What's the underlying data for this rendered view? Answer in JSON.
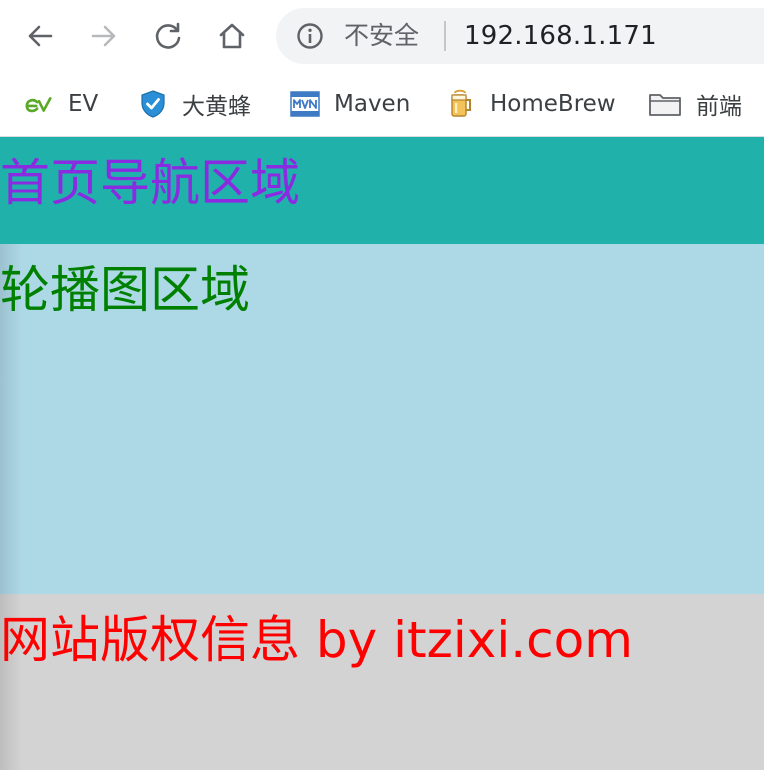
{
  "browser": {
    "security_label": "不安全",
    "url": "192.168.1.171",
    "bookmarks": [
      {
        "label": "EV",
        "icon": "ev-logo-icon"
      },
      {
        "label": "大黄蜂",
        "icon": "shield-check-icon"
      },
      {
        "label": "Maven",
        "icon": "maven-logo-icon"
      },
      {
        "label": "HomeBrew",
        "icon": "beer-mug-icon"
      },
      {
        "label": "前端",
        "icon": "folder-icon"
      }
    ]
  },
  "page": {
    "nav": {
      "text": "首页导航区域",
      "background": "#20b2aa",
      "color": "#8a2be2"
    },
    "banner": {
      "text": "轮播图区域",
      "background": "#add8e6",
      "color": "#008000"
    },
    "footer": {
      "text": "网站版权信息 by itzixi.com",
      "background": "#d3d3d3",
      "color": "#ff0000"
    }
  }
}
